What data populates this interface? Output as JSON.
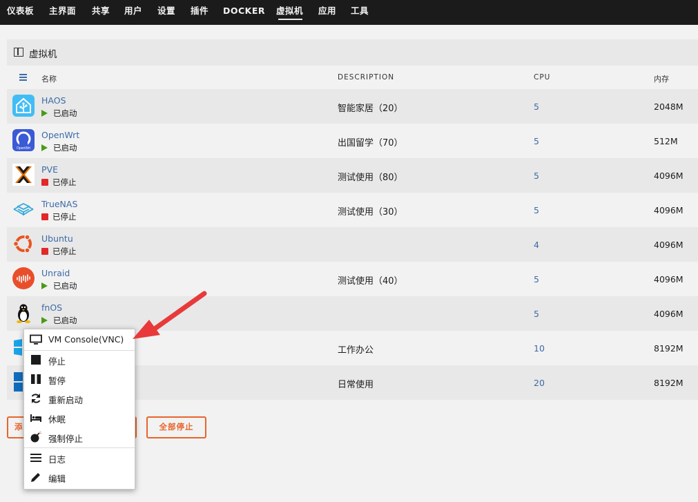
{
  "nav": {
    "items": [
      "仪表板",
      "主界面",
      "共享",
      "用户",
      "设置",
      "插件",
      "DOCKER",
      "虚拟机",
      "应用",
      "工具"
    ],
    "active_index": 7
  },
  "panel": {
    "title": "虚拟机"
  },
  "columns": {
    "name": "名称",
    "description": "DESCRIPTION",
    "cpu": "CPU",
    "memory": "内存"
  },
  "vms": [
    {
      "name": "HAOS",
      "state": "已启动",
      "running": true,
      "description": "智能家居（20）",
      "cpu": "5",
      "memory": "2048M",
      "logo": "home-assistant-icon"
    },
    {
      "name": "OpenWrt",
      "state": "已启动",
      "running": true,
      "description": "出国留学（70）",
      "cpu": "5",
      "memory": "512M",
      "logo": "openwrt-icon"
    },
    {
      "name": "PVE",
      "state": "已停止",
      "running": false,
      "description": "测试使用（80）",
      "cpu": "5",
      "memory": "4096M",
      "logo": "proxmox-icon"
    },
    {
      "name": "TrueNAS",
      "state": "已停止",
      "running": false,
      "description": "测试使用（30）",
      "cpu": "5",
      "memory": "4096M",
      "logo": "truenas-icon"
    },
    {
      "name": "Ubuntu",
      "state": "已停止",
      "running": false,
      "description": "",
      "cpu": "4",
      "memory": "4096M",
      "logo": "ubuntu-icon"
    },
    {
      "name": "Unraid",
      "state": "已启动",
      "running": true,
      "description": "测试使用（40）",
      "cpu": "5",
      "memory": "4096M",
      "logo": "unraid-icon"
    },
    {
      "name": "fnOS",
      "state": "已启动",
      "running": true,
      "description": "",
      "cpu": "5",
      "memory": "4096M",
      "logo": "linux-tux-icon"
    },
    {
      "name": "",
      "state": "",
      "running": null,
      "description": "工作办公",
      "cpu": "10",
      "memory": "8192M",
      "logo": "windows-icon"
    },
    {
      "name": "",
      "state": "",
      "running": null,
      "description": "日常使用",
      "cpu": "20",
      "memory": "8192M",
      "logo": "windows-icon"
    }
  ],
  "buttons": {
    "add_partial": "添",
    "stop_all": "全部停止"
  },
  "context_menu": {
    "items": [
      {
        "label": "VM Console(VNC)",
        "icon": "monitor-icon"
      },
      {
        "label": "停止",
        "icon": "stop-icon"
      },
      {
        "label": "暂停",
        "icon": "pause-icon"
      },
      {
        "label": "重新启动",
        "icon": "refresh-icon"
      },
      {
        "label": "休眠",
        "icon": "bed-icon"
      },
      {
        "label": "强制停止",
        "icon": "bomb-icon"
      },
      {
        "label": "日志",
        "icon": "menu-lines-icon"
      },
      {
        "label": "编辑",
        "icon": "pencil-icon"
      }
    ]
  },
  "colors": {
    "accent": "#3c6aa6",
    "warning": "#e8642a",
    "running": "#4a9a1a",
    "stopped": "#e22828",
    "arrow": "#e83a3a"
  }
}
